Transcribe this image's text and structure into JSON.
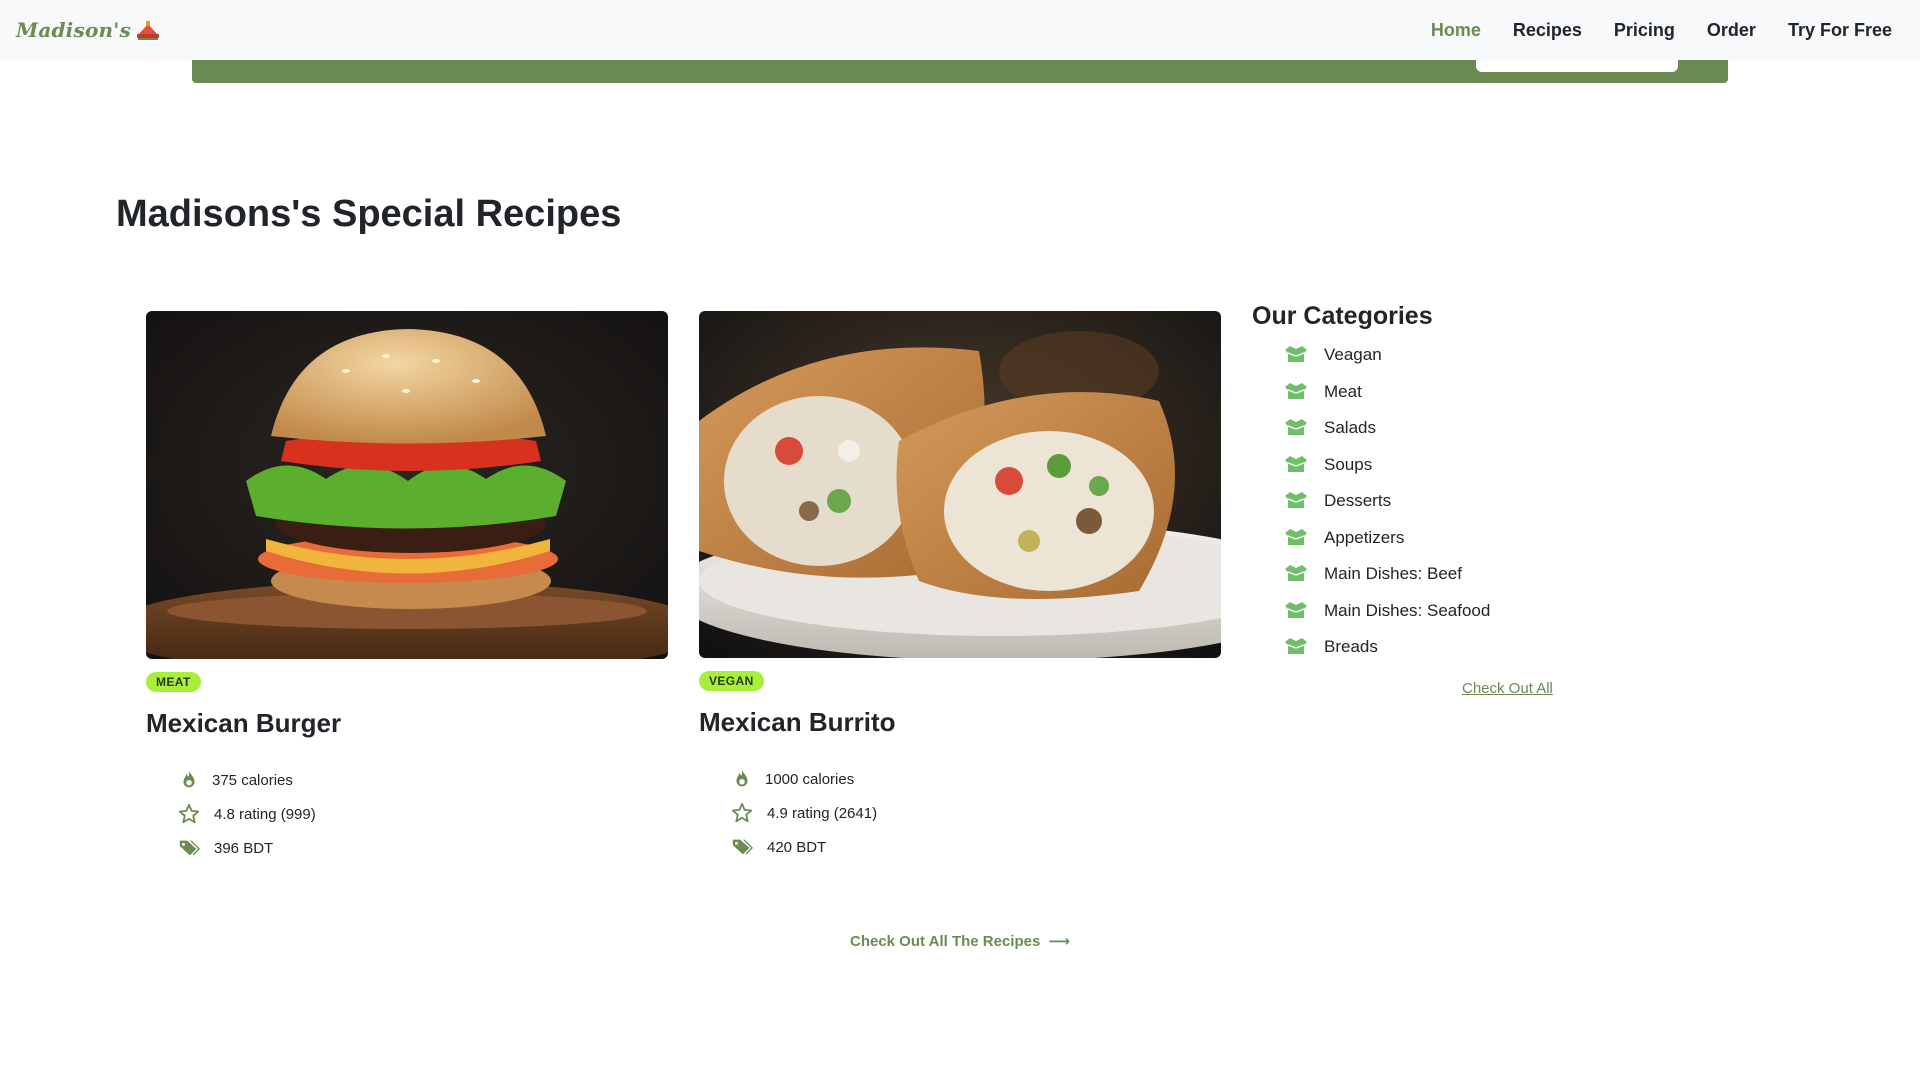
{
  "brand": {
    "name": "Madison's"
  },
  "nav": {
    "items": [
      {
        "label": "Home",
        "active": true
      },
      {
        "label": "Recipes",
        "active": false
      },
      {
        "label": "Pricing",
        "active": false
      },
      {
        "label": "Order",
        "active": false
      },
      {
        "label": "Try For Free",
        "active": false
      }
    ]
  },
  "section": {
    "title": "Madisons's Special Recipes"
  },
  "recipes": [
    {
      "category_badge": "MEAT",
      "title": "Mexican Burger",
      "calories": "375 calories",
      "rating": "4.8 rating (999)",
      "price": "396 BDT"
    },
    {
      "category_badge": "VEGAN",
      "title": "Mexican Burrito",
      "calories": "1000 calories",
      "rating": "4.9 rating (2641)",
      "price": "420 BDT"
    }
  ],
  "categories": {
    "title": "Our Categories",
    "items": [
      "Veagan",
      "Meat",
      "Salads",
      "Soups",
      "Desserts",
      "Appetizers",
      "Main Dishes: Beef",
      "Main Dishes: Seafood",
      "Breads"
    ],
    "check_all_label": "Check Out All"
  },
  "footer_link": {
    "label": "Check Out All The Recipes",
    "arrow": "⟶"
  },
  "colors": {
    "brand_green": "#6a8c53",
    "badge_green": "#a7ef3a",
    "navbar_bg": "#f8f9fa",
    "text_dark": "#212529"
  },
  "icons": {
    "calories": "flame-icon",
    "rating": "star-outline-icon",
    "price": "tags-icon",
    "category": "open-box-icon",
    "arrow": "long-arrow-right-icon"
  }
}
